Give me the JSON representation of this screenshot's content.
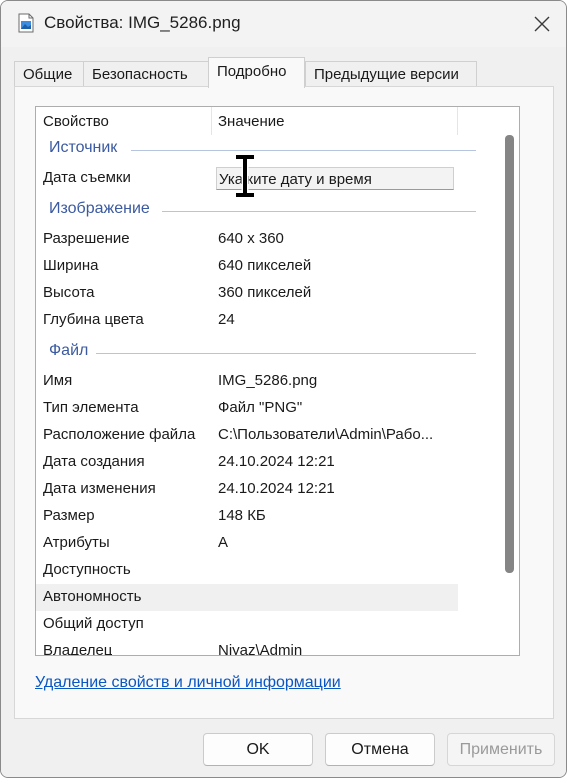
{
  "window": {
    "title": "Свойства: IMG_5286.png"
  },
  "tabs": [
    {
      "label": "Общие"
    },
    {
      "label": "Безопасность"
    },
    {
      "label": "Подробно"
    },
    {
      "label": "Предыдущие версии"
    }
  ],
  "list": {
    "header": {
      "property": "Свойство",
      "value": "Значение"
    },
    "groups": {
      "source": {
        "label": "Источник",
        "rows": [
          {
            "name": "Дата съемки",
            "value": "Укажите дату и время"
          }
        ]
      },
      "image": {
        "label": "Изображение",
        "rows": [
          {
            "name": "Разрешение",
            "value": "640 x 360"
          },
          {
            "name": "Ширина",
            "value": "640 пикселей"
          },
          {
            "name": "Высота",
            "value": "360 пикселей"
          },
          {
            "name": "Глубина цвета",
            "value": "24"
          }
        ]
      },
      "file": {
        "label": "Файл",
        "rows": [
          {
            "name": "Имя",
            "value": "IMG_5286.png"
          },
          {
            "name": "Тип элемента",
            "value": "Файл \"PNG\""
          },
          {
            "name": "Расположение файла",
            "value": "C:\\Пользователи\\Admin\\Рабо..."
          },
          {
            "name": "Дата создания",
            "value": "24.10.2024 12:21"
          },
          {
            "name": "Дата изменения",
            "value": "24.10.2024 12:21"
          },
          {
            "name": "Размер",
            "value": "148 КБ"
          },
          {
            "name": "Атрибуты",
            "value": "A"
          },
          {
            "name": "Доступность",
            "value": ""
          },
          {
            "name": "Автономность",
            "value": ""
          },
          {
            "name": "Общий доступ",
            "value": ""
          },
          {
            "name": "Владелец",
            "value": "Niyaz\\Admin"
          }
        ]
      }
    }
  },
  "remove_link": "Удаление свойств и личной информации",
  "buttons": {
    "ok": "OK",
    "cancel": "Отмена",
    "apply": "Применить"
  },
  "colors": {
    "group_header": "#3b5aa1",
    "link": "#0a56c2",
    "scroll_thumb": "#858585"
  }
}
